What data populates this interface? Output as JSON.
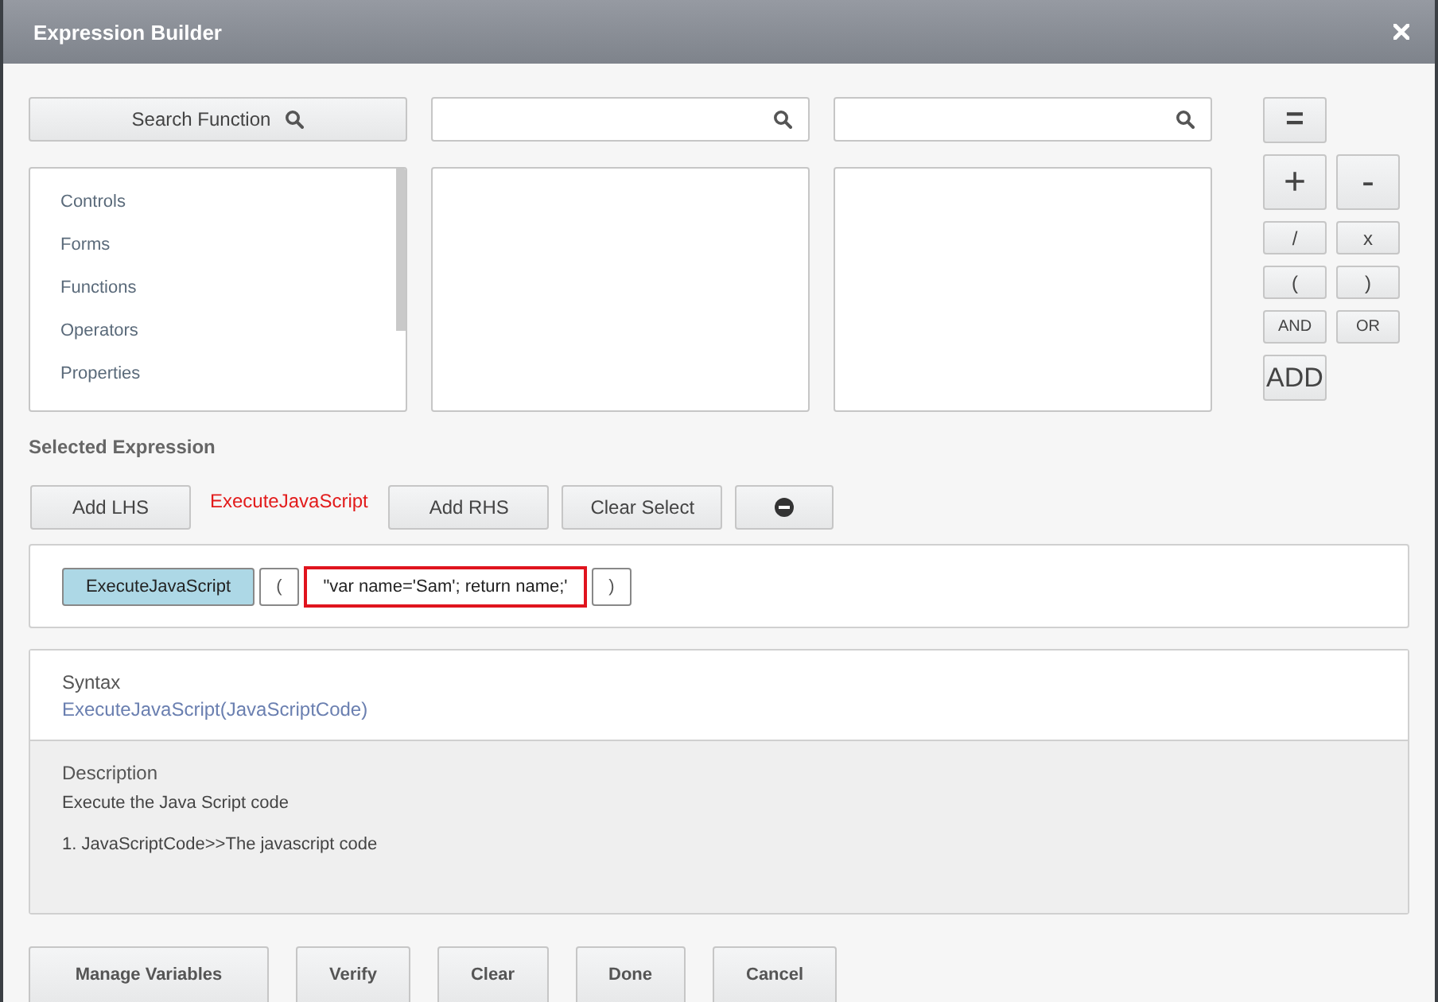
{
  "window": {
    "title": "Expression Builder"
  },
  "search_button": {
    "label": "Search Function"
  },
  "category_list": {
    "items": [
      {
        "label": "Controls"
      },
      {
        "label": "Forms"
      },
      {
        "label": "Functions"
      },
      {
        "label": "Operators"
      },
      {
        "label": "Properties"
      }
    ]
  },
  "operators": {
    "equals": "=",
    "rows": [
      {
        "keys": [
          "+",
          "-"
        ]
      },
      {
        "keys": [
          "/",
          "x"
        ]
      },
      {
        "keys": [
          "(",
          ")"
        ]
      },
      {
        "keys": [
          "AND",
          "OR"
        ]
      }
    ],
    "add": "ADD"
  },
  "selected_expression": {
    "heading": "Selected Expression",
    "add_lhs": "Add LHS",
    "current": "ExecuteJavaScript",
    "add_rhs": "Add RHS",
    "clear_select": "Clear Select",
    "tokens": [
      {
        "kind": "function",
        "text": "ExecuteJavaScript"
      },
      {
        "kind": "paren",
        "text": "("
      },
      {
        "kind": "string",
        "text": "\"var name='Sam'; return name;'"
      },
      {
        "kind": "paren",
        "text": ")"
      }
    ]
  },
  "syntax": {
    "heading": "Syntax",
    "text": "ExecuteJavaScript(JavaScriptCode)"
  },
  "description": {
    "heading": "Description",
    "text": "Execute the Java Script code",
    "params": [
      "1. JavaScriptCode>>The javascript code"
    ]
  },
  "footer_buttons": [
    "Manage Variables",
    "Verify",
    "Clear",
    "Done",
    "Cancel"
  ]
}
